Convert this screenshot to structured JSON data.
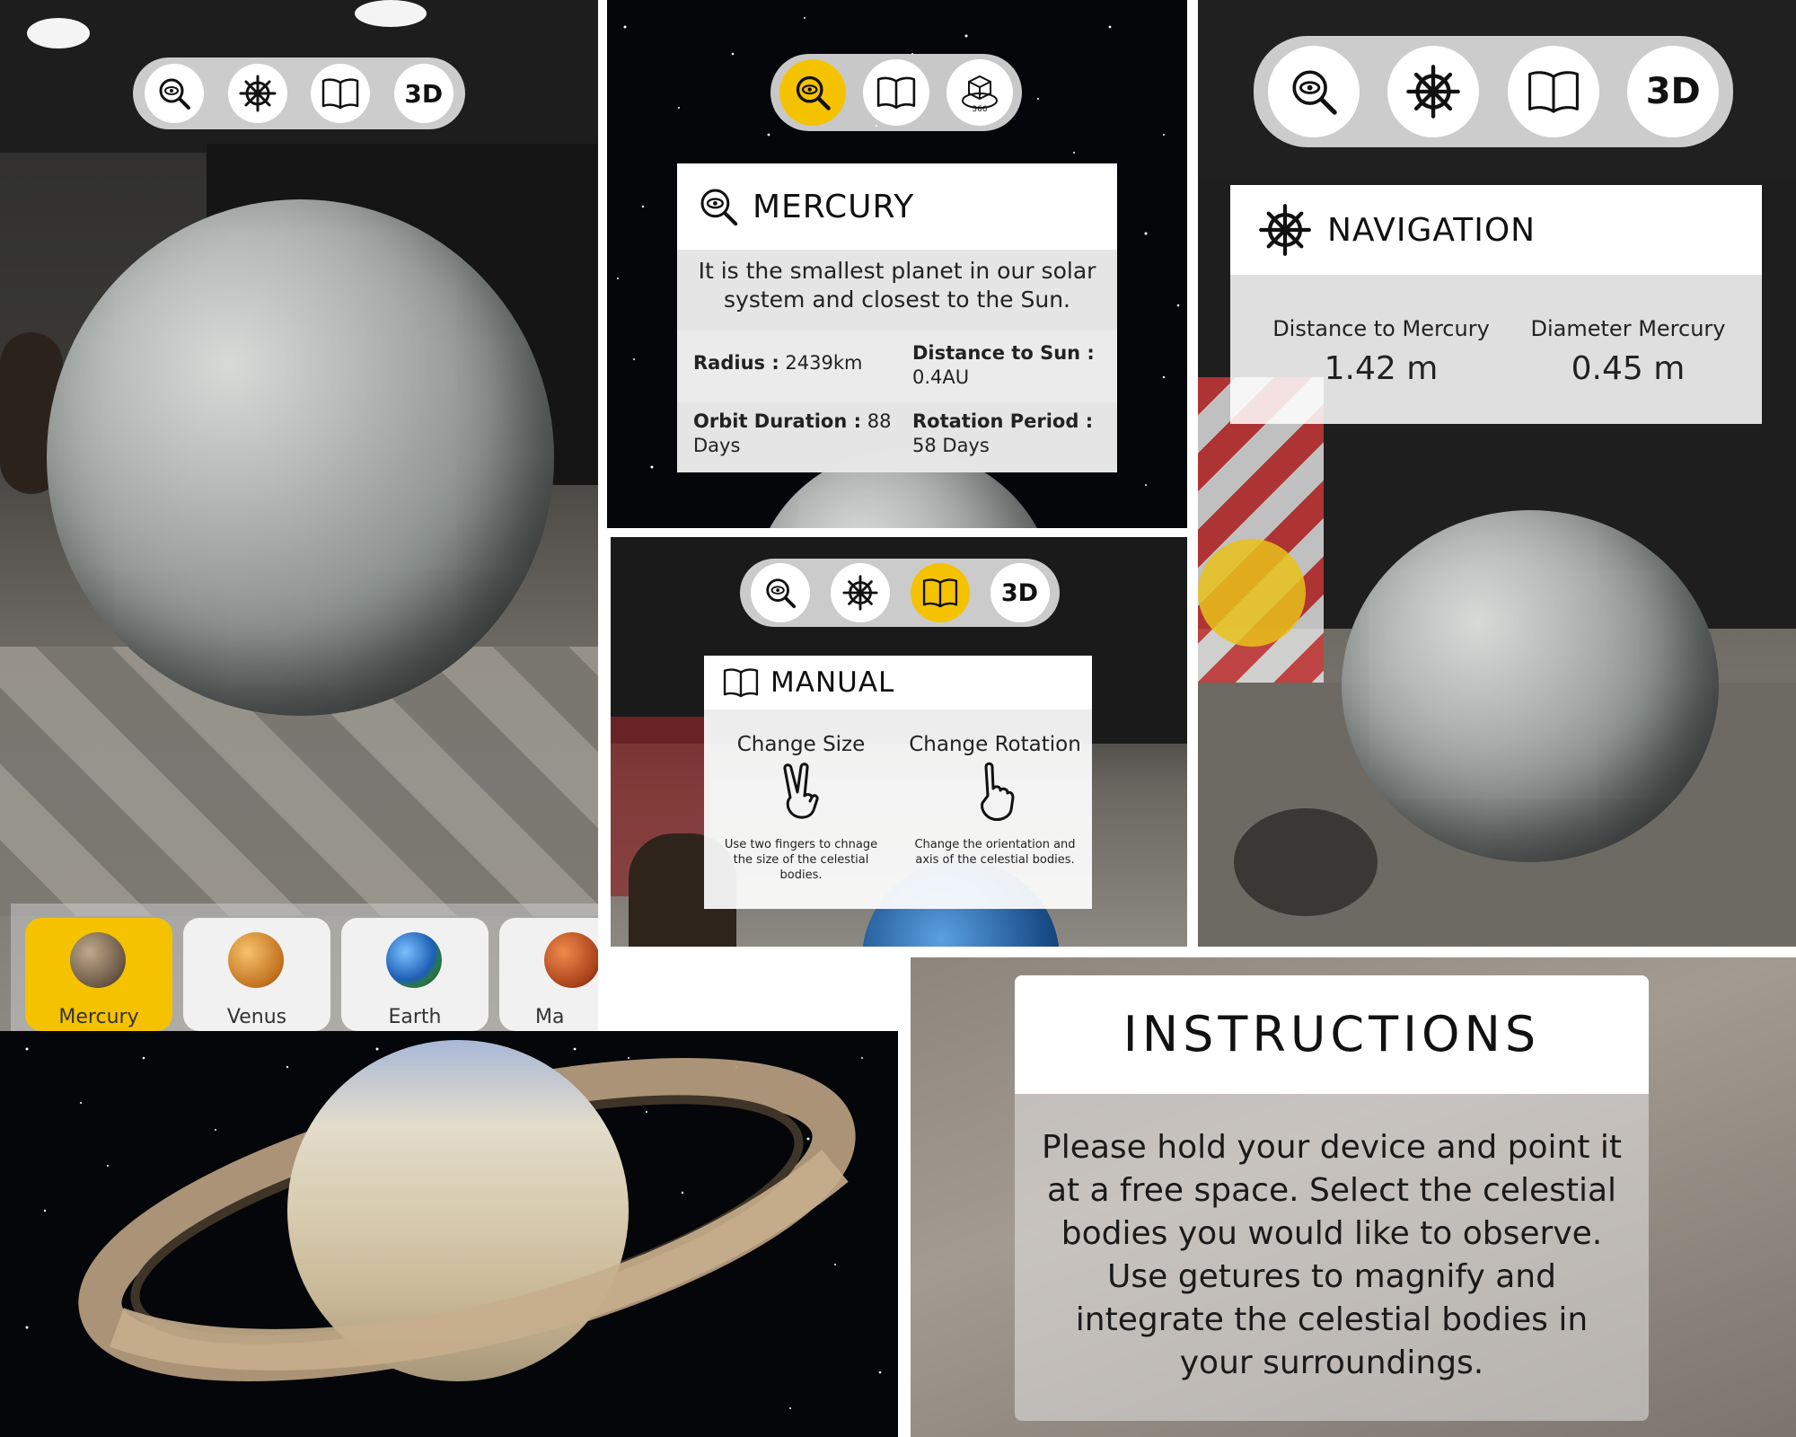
{
  "colors": {
    "accent": "#f5c200",
    "card_bg": "#ffffff",
    "text": "#222222"
  },
  "toolbar": {
    "explore_icon": "eye-magnifier-icon",
    "navigation_icon": "ship-wheel-icon",
    "manual_icon": "open-book-icon",
    "label_3d": "3D",
    "icon_360": "cube-360-icon"
  },
  "planet_selector": {
    "items": [
      {
        "label": "Mercury",
        "icon": "mercury-icon",
        "active": true
      },
      {
        "label": "Venus",
        "icon": "venus-icon",
        "active": false
      },
      {
        "label": "Earth",
        "icon": "earth-icon",
        "active": false
      },
      {
        "label": "Ma",
        "icon": "mars-icon",
        "active": false
      }
    ]
  },
  "mercury_info": {
    "title": "MERCURY",
    "description": "It is the smallest planet in our solar system and closest to the Sun.",
    "radius_label": "Radius :",
    "radius_value": "2439km",
    "distance_label": "Distance to Sun :",
    "distance_value": "0.4AU",
    "orbit_label": "Orbit Duration :",
    "orbit_value": "88 Days",
    "rotation_label": "Rotation Period :",
    "rotation_value": "58 Days"
  },
  "manual": {
    "title": "MANUAL",
    "size_title": "Change Size",
    "size_icon": "two-finger-gesture-icon",
    "size_desc": "Use two fingers to chnage the size of the celestial bodies.",
    "rotation_title": "Change Rotation",
    "rotation_icon": "one-finger-gesture-icon",
    "rotation_desc": "Change the orientation and axis of the celestial bodies."
  },
  "navigation": {
    "title": "NAVIGATION",
    "distance_label": "Distance to Mercury",
    "distance_value": "1.42 m",
    "diameter_label": "Diameter Mercury",
    "diameter_value": "0.45 m"
  },
  "instructions": {
    "title": "INSTRUCTIONS",
    "body": "Please hold your device and point it at a free space. Select the celestial bodies you would like to observe. Use getures to magnify and integrate the celestial bodies in your surroundings."
  }
}
